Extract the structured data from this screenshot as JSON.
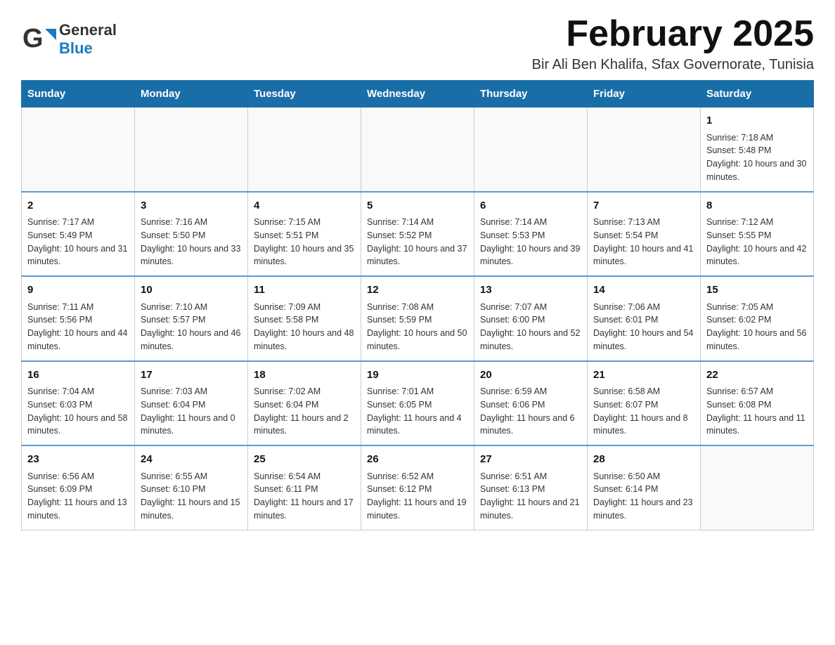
{
  "header": {
    "logo_text_general": "General",
    "logo_text_blue": "Blue",
    "month_title": "February 2025",
    "location": "Bir Ali Ben Khalifa, Sfax Governorate, Tunisia"
  },
  "weekdays": [
    "Sunday",
    "Monday",
    "Tuesday",
    "Wednesday",
    "Thursday",
    "Friday",
    "Saturday"
  ],
  "weeks": [
    [
      {
        "day": "",
        "info": ""
      },
      {
        "day": "",
        "info": ""
      },
      {
        "day": "",
        "info": ""
      },
      {
        "day": "",
        "info": ""
      },
      {
        "day": "",
        "info": ""
      },
      {
        "day": "",
        "info": ""
      },
      {
        "day": "1",
        "info": "Sunrise: 7:18 AM\nSunset: 5:48 PM\nDaylight: 10 hours and 30 minutes."
      }
    ],
    [
      {
        "day": "2",
        "info": "Sunrise: 7:17 AM\nSunset: 5:49 PM\nDaylight: 10 hours and 31 minutes."
      },
      {
        "day": "3",
        "info": "Sunrise: 7:16 AM\nSunset: 5:50 PM\nDaylight: 10 hours and 33 minutes."
      },
      {
        "day": "4",
        "info": "Sunrise: 7:15 AM\nSunset: 5:51 PM\nDaylight: 10 hours and 35 minutes."
      },
      {
        "day": "5",
        "info": "Sunrise: 7:14 AM\nSunset: 5:52 PM\nDaylight: 10 hours and 37 minutes."
      },
      {
        "day": "6",
        "info": "Sunrise: 7:14 AM\nSunset: 5:53 PM\nDaylight: 10 hours and 39 minutes."
      },
      {
        "day": "7",
        "info": "Sunrise: 7:13 AM\nSunset: 5:54 PM\nDaylight: 10 hours and 41 minutes."
      },
      {
        "day": "8",
        "info": "Sunrise: 7:12 AM\nSunset: 5:55 PM\nDaylight: 10 hours and 42 minutes."
      }
    ],
    [
      {
        "day": "9",
        "info": "Sunrise: 7:11 AM\nSunset: 5:56 PM\nDaylight: 10 hours and 44 minutes."
      },
      {
        "day": "10",
        "info": "Sunrise: 7:10 AM\nSunset: 5:57 PM\nDaylight: 10 hours and 46 minutes."
      },
      {
        "day": "11",
        "info": "Sunrise: 7:09 AM\nSunset: 5:58 PM\nDaylight: 10 hours and 48 minutes."
      },
      {
        "day": "12",
        "info": "Sunrise: 7:08 AM\nSunset: 5:59 PM\nDaylight: 10 hours and 50 minutes."
      },
      {
        "day": "13",
        "info": "Sunrise: 7:07 AM\nSunset: 6:00 PM\nDaylight: 10 hours and 52 minutes."
      },
      {
        "day": "14",
        "info": "Sunrise: 7:06 AM\nSunset: 6:01 PM\nDaylight: 10 hours and 54 minutes."
      },
      {
        "day": "15",
        "info": "Sunrise: 7:05 AM\nSunset: 6:02 PM\nDaylight: 10 hours and 56 minutes."
      }
    ],
    [
      {
        "day": "16",
        "info": "Sunrise: 7:04 AM\nSunset: 6:03 PM\nDaylight: 10 hours and 58 minutes."
      },
      {
        "day": "17",
        "info": "Sunrise: 7:03 AM\nSunset: 6:04 PM\nDaylight: 11 hours and 0 minutes."
      },
      {
        "day": "18",
        "info": "Sunrise: 7:02 AM\nSunset: 6:04 PM\nDaylight: 11 hours and 2 minutes."
      },
      {
        "day": "19",
        "info": "Sunrise: 7:01 AM\nSunset: 6:05 PM\nDaylight: 11 hours and 4 minutes."
      },
      {
        "day": "20",
        "info": "Sunrise: 6:59 AM\nSunset: 6:06 PM\nDaylight: 11 hours and 6 minutes."
      },
      {
        "day": "21",
        "info": "Sunrise: 6:58 AM\nSunset: 6:07 PM\nDaylight: 11 hours and 8 minutes."
      },
      {
        "day": "22",
        "info": "Sunrise: 6:57 AM\nSunset: 6:08 PM\nDaylight: 11 hours and 11 minutes."
      }
    ],
    [
      {
        "day": "23",
        "info": "Sunrise: 6:56 AM\nSunset: 6:09 PM\nDaylight: 11 hours and 13 minutes."
      },
      {
        "day": "24",
        "info": "Sunrise: 6:55 AM\nSunset: 6:10 PM\nDaylight: 11 hours and 15 minutes."
      },
      {
        "day": "25",
        "info": "Sunrise: 6:54 AM\nSunset: 6:11 PM\nDaylight: 11 hours and 17 minutes."
      },
      {
        "day": "26",
        "info": "Sunrise: 6:52 AM\nSunset: 6:12 PM\nDaylight: 11 hours and 19 minutes."
      },
      {
        "day": "27",
        "info": "Sunrise: 6:51 AM\nSunset: 6:13 PM\nDaylight: 11 hours and 21 minutes."
      },
      {
        "day": "28",
        "info": "Sunrise: 6:50 AM\nSunset: 6:14 PM\nDaylight: 11 hours and 23 minutes."
      },
      {
        "day": "",
        "info": ""
      }
    ]
  ]
}
